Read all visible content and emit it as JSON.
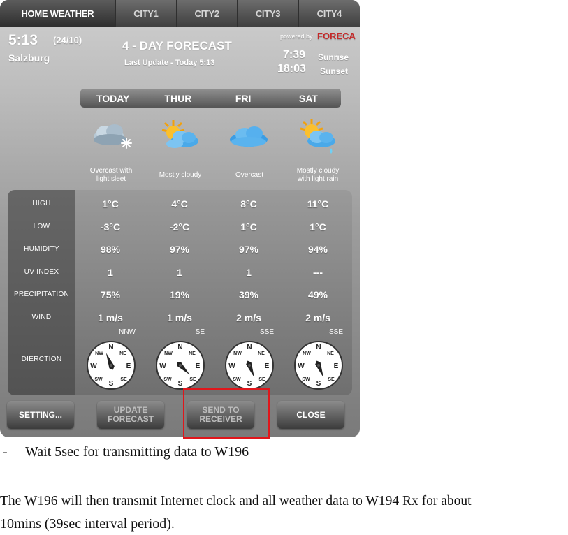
{
  "tabs": [
    "HOME WEATHER",
    "CITY1",
    "CITY2",
    "CITY3",
    "CITY4"
  ],
  "header": {
    "time": "5:13",
    "date": "(24/10)",
    "city": "Salzburg",
    "title": "4 - DAY FORECAST",
    "last_update": "Last Update - Today 5:13",
    "powered_by": "powered by",
    "logo": "FORECA",
    "sunrise_time": "7:39",
    "sunrise_label": "Sunrise",
    "sunset_time": "18:03",
    "sunset_label": "Sunset"
  },
  "days": [
    {
      "name": "TODAY",
      "icon": "cloud-sleet-icon",
      "desc1": "Overcast with",
      "desc2": "light sleet",
      "high": "1°C",
      "low": "-3°C",
      "humidity": "98%",
      "uv": "1",
      "precip": "75%",
      "wind": "1 m/s",
      "dir": "NNW",
      "needle_deg": -22
    },
    {
      "name": "THUR",
      "icon": "sun-cloud-icon",
      "desc1": "Mostly cloudy",
      "desc2": "",
      "high": "4°C",
      "low": "-2°C",
      "humidity": "97%",
      "uv": "1",
      "precip": "19%",
      "wind": "1 m/s",
      "dir": "SE",
      "needle_deg": 135
    },
    {
      "name": "FRI",
      "icon": "cloud-icon",
      "desc1": "Overcast",
      "desc2": "",
      "high": "8°C",
      "low": "1°C",
      "humidity": "97%",
      "uv": "1",
      "precip": "39%",
      "wind": "2 m/s",
      "dir": "SSE",
      "needle_deg": 158
    },
    {
      "name": "SAT",
      "icon": "sun-cloud-rain-icon",
      "desc1": "Mostly cloudy",
      "desc2": "with light rain",
      "high": "11°C",
      "low": "1°C",
      "humidity": "94%",
      "uv": "---",
      "precip": "49%",
      "wind": "2 m/s",
      "dir": "SSE",
      "needle_deg": 158
    }
  ],
  "rows": [
    "HIGH",
    "LOW",
    "HUMIDITY",
    "UV INDEX",
    "PRECIPITATION",
    "WIND",
    "DIERCTION"
  ],
  "compass_letters": {
    "n": "N",
    "s": "S",
    "e": "E",
    "w": "W",
    "ne": "NE",
    "nw": "NW",
    "se": "SE",
    "sw": "SW"
  },
  "buttons": {
    "setting": "SETTING...",
    "update": "UPDATE\nFORECAST",
    "send": "SEND TO\nRECEIVER",
    "close": "CLOSE"
  },
  "doc": {
    "dash": "-",
    "step": "Wait 5sec for transmitting data to W196",
    "para_line1": "The W196 will then transmit Internet clock and all weather data to W194 Rx for about",
    "para_line2": "10mins (39sec interval period)."
  },
  "colors": {
    "highlight": "#e0161b",
    "logo": "#c62828"
  }
}
